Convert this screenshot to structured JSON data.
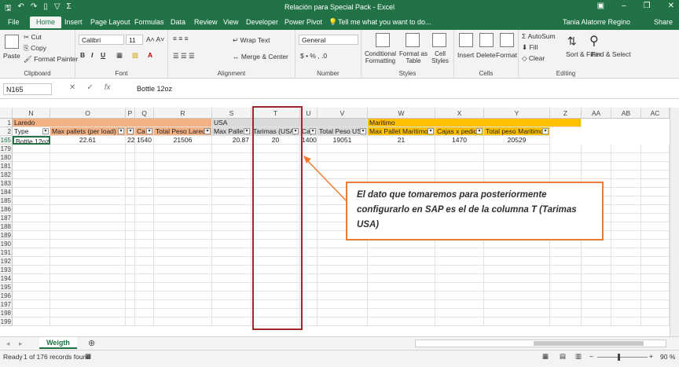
{
  "window": {
    "title": "Relación para Special Pack - Excel",
    "user": "Tania Alatorre Regino",
    "share": "Share",
    "tell_me": "Tell me what you want to do..."
  },
  "tabs": [
    "File",
    "Home",
    "Insert",
    "Page Layout",
    "Formulas",
    "Data",
    "Review",
    "View",
    "Developer",
    "Power Pivot"
  ],
  "ribbon": {
    "clipboard": {
      "label": "Clipboard",
      "paste": "Paste",
      "cut": "Cut",
      "copy": "Copy",
      "format_painter": "Format Painter"
    },
    "font": {
      "label": "Font",
      "name": "Calibri",
      "size": "11"
    },
    "alignment": {
      "label": "Alignment",
      "wrap": "Wrap Text",
      "merge": "Merge & Center"
    },
    "number": {
      "label": "Number",
      "format": "General"
    },
    "styles": {
      "label": "Styles",
      "conditional": "Conditional Formatting",
      "format_table": "Format as Table",
      "cell_styles": "Cell Styles"
    },
    "cells": {
      "label": "Cells",
      "insert": "Insert",
      "delete": "Delete",
      "format": "Format"
    },
    "editing": {
      "label": "Editing",
      "autosum": "AutoSum",
      "fill": "Fill",
      "clear": "Clear",
      "sort": "Sort & Filter",
      "find": "Find & Select"
    }
  },
  "formula_bar": {
    "name_box": "N165",
    "value": "Bottle 12oz"
  },
  "columns": [
    "N",
    "O",
    "P",
    "Q",
    "R",
    "S",
    "T",
    "U",
    "V",
    "W",
    "X",
    "Y",
    "Z",
    "AA",
    "AB",
    "AC"
  ],
  "rows": {
    "row1": {
      "num": "1",
      "laredo": "Laredo",
      "usa": "USA",
      "maritimo": "Maritimo"
    },
    "row2": {
      "num": "2",
      "type": "Type",
      "max_pallets_laredo": "Max pallets  (per load)",
      "p": "Ca",
      "total_peso_laredo": "Total Peso Laredo",
      "max_pallet_usa": "Max Pallet",
      "tarimas_usa": "Tarimas (USA)",
      "u": "Caj",
      "total_peso_usa": "Total Peso USA",
      "max_pallet_maritimo": "Max Pallet Maritimo",
      "cajas_pedido": "Cajas x pedido",
      "total_peso_maritimo": "Total peso Maritimo"
    },
    "row165": {
      "num": "165",
      "type": "Bottle 12oz",
      "o": "22.61",
      "p": "22",
      "q": "1540",
      "r": "21506",
      "s": "20.87",
      "t": "20",
      "u": "1400",
      "v": "19051",
      "w": "21",
      "x": "1470",
      "y": "20529"
    },
    "empty_rows": [
      "179",
      "180",
      "181",
      "182",
      "183",
      "184",
      "185",
      "186",
      "187",
      "188",
      "189",
      "190",
      "191",
      "192",
      "193",
      "194",
      "195",
      "196",
      "197",
      "198",
      "199"
    ]
  },
  "sheet": {
    "tab_name": "Weigth"
  },
  "status": {
    "ready": "Ready",
    "records": "1 of 176 records found",
    "zoom": "90 %"
  },
  "annotation": {
    "text": "El dato que tomaremos para posteriormente configurarlo en SAP es el de la columna T (Tarimas USA)"
  }
}
